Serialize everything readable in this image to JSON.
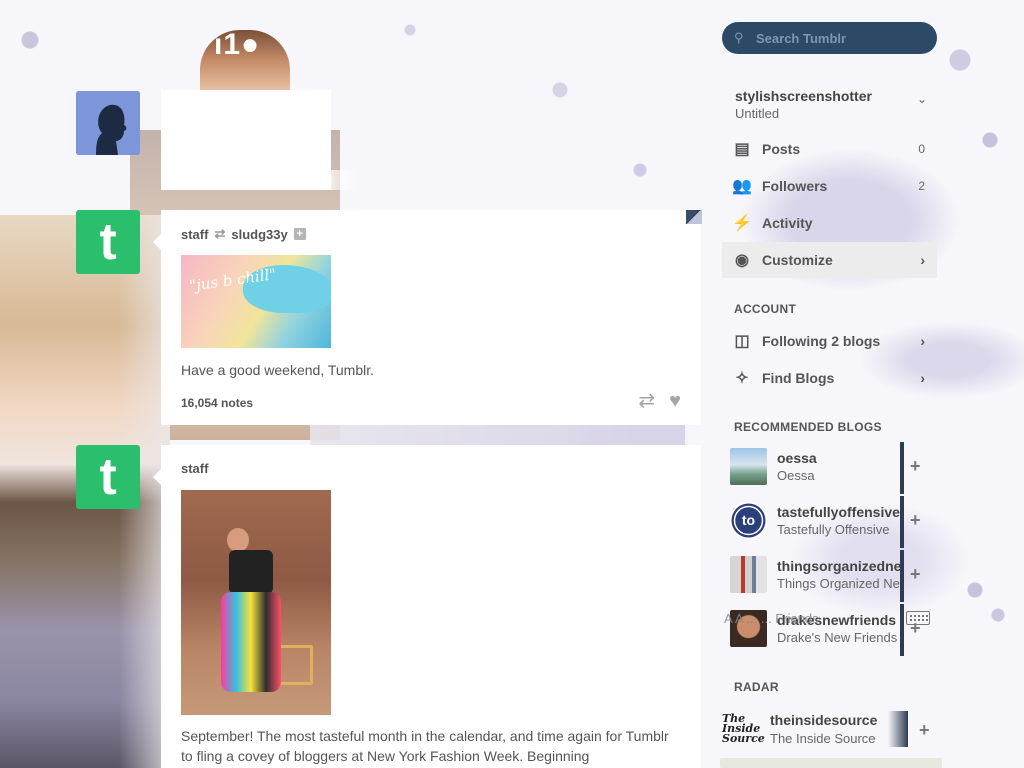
{
  "background": {
    "logo_fragment": "ı1●"
  },
  "posts": [
    {
      "author": "staff",
      "reblogged_from": "sludg33y",
      "image_text": "\"jus b chill\"",
      "body": "Have a good weekend, Tumblr.",
      "notes": "16,054 notes",
      "avatar_letter": "t"
    },
    {
      "author": "staff",
      "body": "September! The most tasteful month in the calendar, and time again for Tumblr to fling a covey of bloggers at New York Fashion Week. Beginning",
      "avatar_letter": "t"
    }
  ],
  "sidebar": {
    "search_placeholder": "Search Tumblr",
    "blog": {
      "name": "stylishscreenshotter",
      "title": "Untitled"
    },
    "menu": [
      {
        "label": "Posts",
        "count": "0",
        "icon": "posts-icon"
      },
      {
        "label": "Followers",
        "count": "2",
        "icon": "followers-icon"
      },
      {
        "label": "Activity",
        "icon": "activity-icon"
      },
      {
        "label": "Customize",
        "icon": "eye-icon"
      }
    ],
    "account_label": "ACCOUNT",
    "account_items": [
      {
        "label": "Following 2 blogs",
        "icon": "following-icon"
      },
      {
        "label": "Find Blogs",
        "icon": "find-blogs-icon"
      }
    ],
    "recommended_label": "RECOMMENDED BLOGS",
    "recommended": [
      {
        "name": "oessa",
        "subtitle": "Oessa"
      },
      {
        "name": "tastefullyoffensive",
        "subtitle": "Tastefully Offensive"
      },
      {
        "name": "thingsorganizedneatly",
        "subtitle": "Things Organized Neatly"
      },
      {
        "name": "drakesnewfriends",
        "subtitle": "Drake's New Friends"
      }
    ],
    "overlay_text": "A  A  ...  ... Friends",
    "radar_label": "RADAR",
    "radar": {
      "name": "theinsidesource",
      "subtitle": "The Inside Source",
      "logo_text": "The Inside Source"
    },
    "follow_symbol": "+"
  }
}
